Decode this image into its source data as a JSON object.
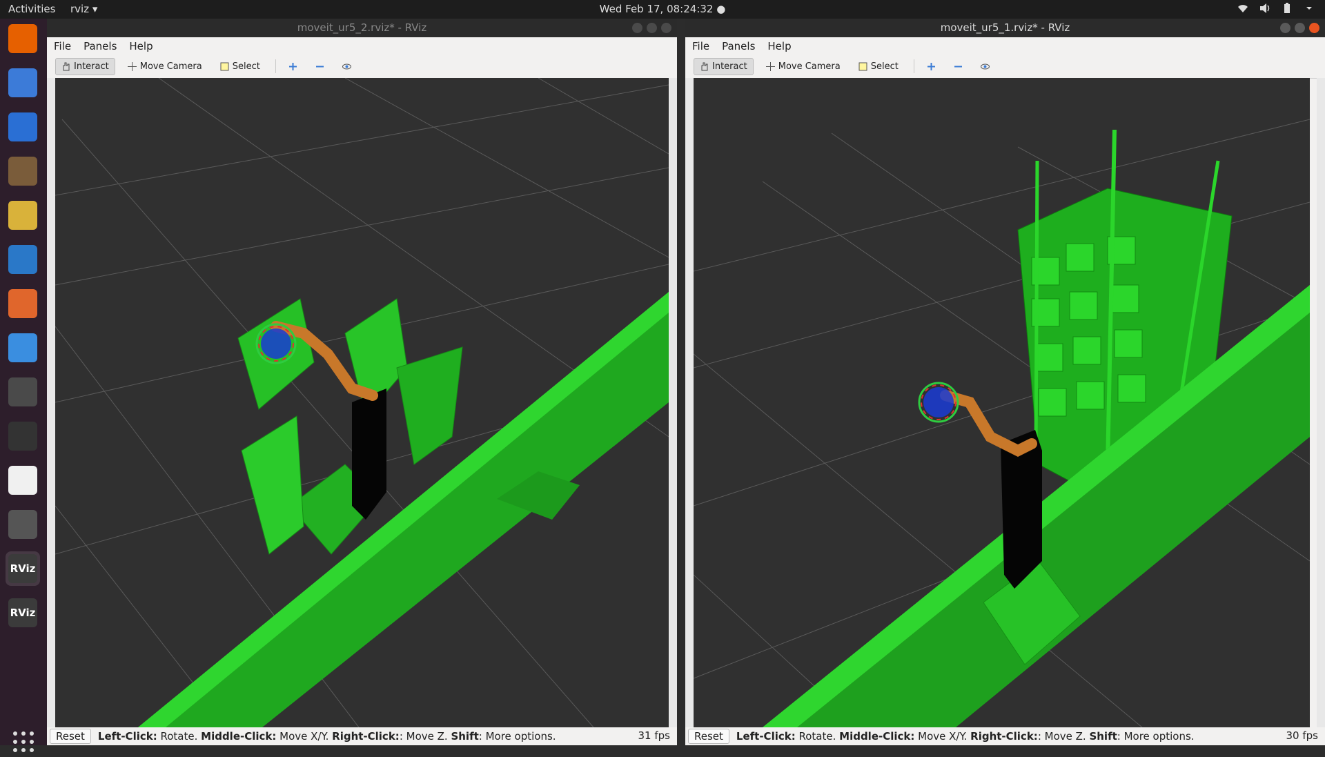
{
  "topbar": {
    "activities": "Activities",
    "app_menu": "rviz ▾",
    "clock": "Wed Feb 17, 08:24:32 ●"
  },
  "dock": {
    "items": [
      {
        "name": "firefox-icon",
        "color": "#e66000"
      },
      {
        "name": "chromium-icon",
        "color": "#3c7bd8"
      },
      {
        "name": "thunderbird-icon",
        "color": "#2a6fd4"
      },
      {
        "name": "files-icon",
        "color": "#7a5c3a"
      },
      {
        "name": "rhythmbox-icon",
        "color": "#d9b23a"
      },
      {
        "name": "libreoffice-writer-icon",
        "color": "#2a78c8"
      },
      {
        "name": "software-center-icon",
        "color": "#e0662c"
      },
      {
        "name": "help-icon",
        "color": "#3a8ee0"
      },
      {
        "name": "sublime-text-icon",
        "color": "#4a4a4a"
      },
      {
        "name": "terminal-icon",
        "color": "#333333"
      },
      {
        "name": "text-editor-icon",
        "color": "#f0f0f0"
      },
      {
        "name": "virtualbox-icon",
        "color": "#555555"
      },
      {
        "name": "rviz-icon",
        "color": "#3b3b3b",
        "label": "RViz"
      },
      {
        "name": "rviz-icon-2",
        "color": "#3b3b3b",
        "label": "RViz"
      }
    ]
  },
  "windows": [
    {
      "title": "moveit_ur5_2.rviz* - RViz",
      "menu": [
        "File",
        "Panels",
        "Help"
      ],
      "tools": {
        "interact": "Interact",
        "move_camera": "Move Camera",
        "select": "Select"
      },
      "status": {
        "reset": "Reset",
        "hint_left_key": "Left-Click:",
        "hint_left": " Rotate. ",
        "hint_middle_key": "Middle-Click:",
        "hint_middle": " Move X/Y. ",
        "hint_right_key": "Right-Click:",
        "hint_right": ": Move Z. ",
        "hint_shift_key": "Shift",
        "hint_shift": ": More options.",
        "fps": "31 fps"
      }
    },
    {
      "title": "moveit_ur5_1.rviz* - RViz",
      "menu": [
        "File",
        "Panels",
        "Help"
      ],
      "tools": {
        "interact": "Interact",
        "move_camera": "Move Camera",
        "select": "Select"
      },
      "status": {
        "reset": "Reset",
        "hint_left_key": "Left-Click:",
        "hint_left": " Rotate. ",
        "hint_middle_key": "Middle-Click:",
        "hint_middle": " Move X/Y. ",
        "hint_right_key": "Right-Click:",
        "hint_right": ": Move Z. ",
        "hint_shift_key": "Shift",
        "hint_shift": ": More options.",
        "fps": "30 fps"
      }
    }
  ],
  "colors": {
    "accent": "#e95420",
    "scene_green": "#22c422",
    "robot_orange": "#c8782a",
    "viewport_bg": "#303030"
  }
}
